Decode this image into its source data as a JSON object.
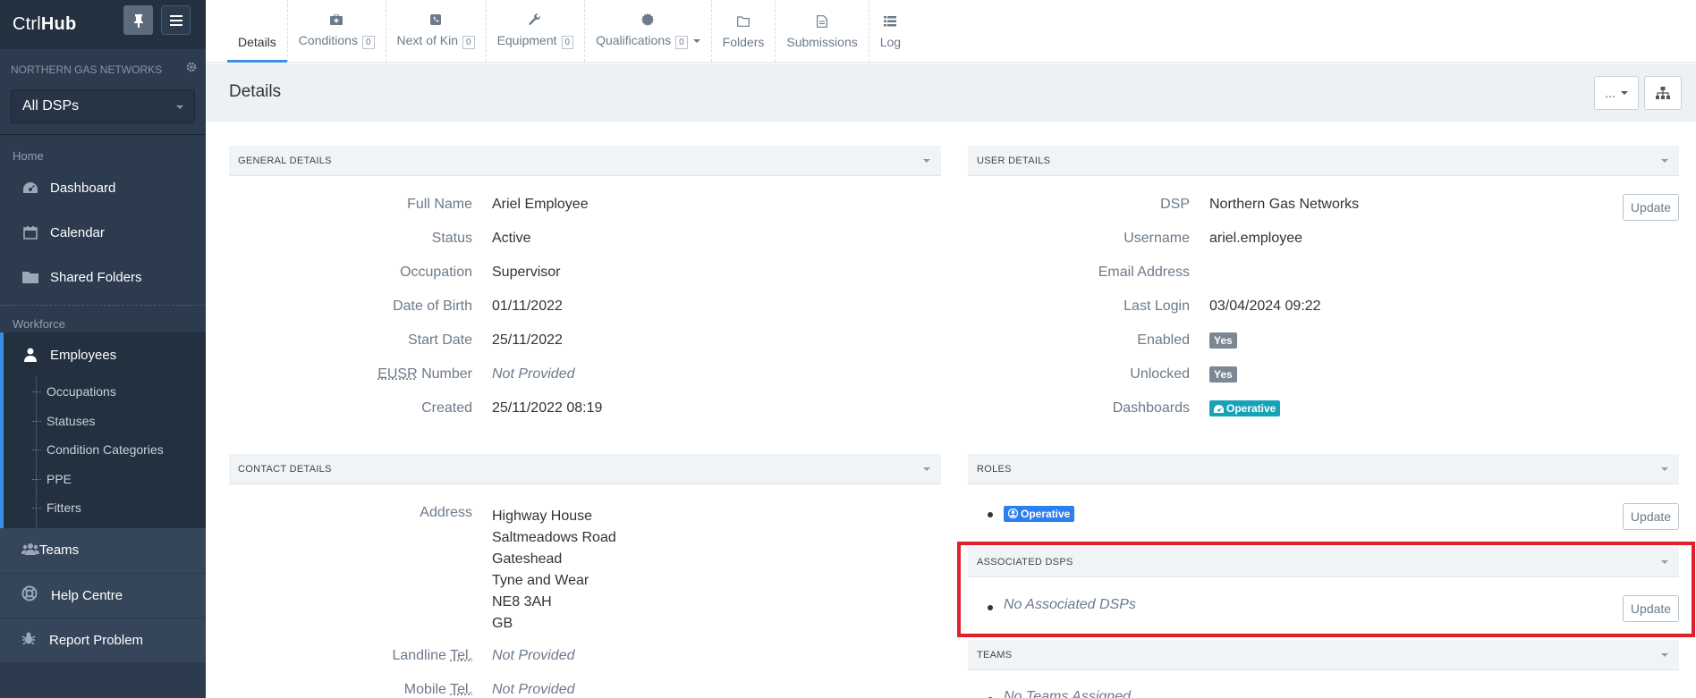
{
  "brand": {
    "name_light": "Ctrl",
    "name_bold": "Hub"
  },
  "sidebar": {
    "org_name": "NORTHERN GAS NETWORKS",
    "dsp_select": "All DSPs",
    "section_home": "Home",
    "home_items": [
      {
        "label": "Dashboard",
        "icon": "dashboard-icon"
      },
      {
        "label": "Calendar",
        "icon": "calendar-icon"
      },
      {
        "label": "Shared Folders",
        "icon": "folder-icon"
      }
    ],
    "section_workforce": "Workforce",
    "employees_label": "Employees",
    "employee_sub": [
      "Occupations",
      "Statuses",
      "Condition Categories",
      "PPE",
      "Fitters"
    ],
    "bottom_items": [
      {
        "label": "Teams",
        "icon": "users-icon"
      },
      {
        "label": "Help Centre",
        "icon": "lifebuoy-icon"
      },
      {
        "label": "Report Problem",
        "icon": "bug-icon"
      }
    ]
  },
  "tabs": [
    {
      "label": "Details",
      "icon": "",
      "count": null
    },
    {
      "label": "Conditions",
      "icon": "medkit-icon",
      "count": "0"
    },
    {
      "label": "Next of Kin",
      "icon": "phone-icon",
      "count": "0"
    },
    {
      "label": "Equipment",
      "icon": "wrench-icon",
      "count": "0"
    },
    {
      "label": "Qualifications",
      "icon": "certificate-icon",
      "count": "0"
    },
    {
      "label": "Folders",
      "icon": "folder-icon",
      "count": null
    },
    {
      "label": "Submissions",
      "icon": "file-icon",
      "count": null
    },
    {
      "label": "Log",
      "icon": "list-icon",
      "count": null
    }
  ],
  "page": {
    "title": "Details",
    "more_label": "..."
  },
  "general_details": {
    "title": "GENERAL DETAILS",
    "full_name_label": "Full Name",
    "full_name": "Ariel Employee",
    "status_label": "Status",
    "status": "Active",
    "occupation_label": "Occupation",
    "occupation": "Supervisor",
    "dob_label": "Date of Birth",
    "dob": "01/11/2022",
    "start_label": "Start Date",
    "start": "25/11/2022",
    "eusr_abbr": "EUSR",
    "eusr_label": " Number",
    "eusr": "Not Provided",
    "created_label": "Created",
    "created": "25/11/2022 08:19"
  },
  "user_details": {
    "title": "USER DETAILS",
    "dsp_label": "DSP",
    "dsp": "Northern Gas Networks",
    "username_label": "Username",
    "username": "ariel.employee",
    "email_label": "Email Address",
    "last_login_label": "Last Login",
    "last_login": "03/04/2024 09:22",
    "enabled_label": "Enabled",
    "enabled": "Yes",
    "unlocked_label": "Unlocked",
    "unlocked": "Yes",
    "dashboards_label": "Dashboards",
    "dashboard": "Operative",
    "update_label": "Update"
  },
  "contact_details": {
    "title": "CONTACT DETAILS",
    "address_label": "Address",
    "address_lines": [
      "Highway House",
      "Saltmeadows Road",
      "Gateshead",
      "Tyne and Wear",
      "NE8 3AH",
      "GB"
    ],
    "landline_label": "Landline ",
    "landline_abbr": "Tel.",
    "landline": "Not Provided",
    "mobile_label": "Mobile ",
    "mobile_abbr": "Tel.",
    "mobile": "Not Provided"
  },
  "roles": {
    "title": "ROLES",
    "role": "Operative",
    "update_label": "Update"
  },
  "associated_dsps": {
    "title": "ASSOCIATED DSPS",
    "empty": "No Associated DSPs",
    "update_label": "Update"
  },
  "teams": {
    "title": "TEAMS",
    "empty": "No Teams Assigned"
  },
  "colors": {
    "sidebar_bg": "#2c3b4e",
    "accent": "#3a8ee6",
    "highlight": "#e0202c",
    "teal_badge": "#17a2b8",
    "role_badge": "#2d7ff0"
  }
}
